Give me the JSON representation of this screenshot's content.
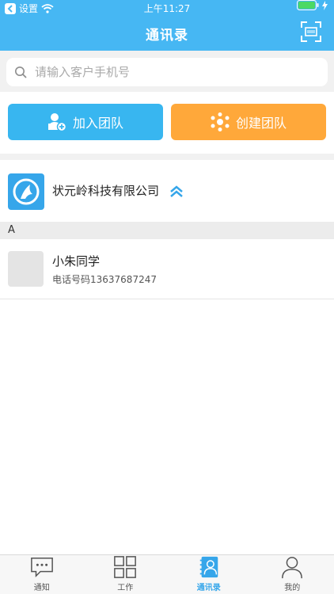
{
  "status_bar": {
    "back_app": "设置",
    "time": "上午11:27"
  },
  "header": {
    "title": "通讯录"
  },
  "search": {
    "placeholder": "请输入客户手机号",
    "value": ""
  },
  "actions": {
    "join_label": "加入团队",
    "create_label": "创建团队"
  },
  "company": {
    "name": "状元岭科技有限公司"
  },
  "contacts": {
    "section_letter": "A",
    "items": [
      {
        "name": "小朱同学",
        "phone": "电话号码13637687247"
      }
    ]
  },
  "tabs": [
    {
      "label": "通知",
      "icon": "chat-icon",
      "active": false
    },
    {
      "label": "工作",
      "icon": "grid-icon",
      "active": false
    },
    {
      "label": "通讯录",
      "icon": "contacts-book-icon",
      "active": true
    },
    {
      "label": "我的",
      "icon": "person-icon",
      "active": false
    }
  ],
  "colors": {
    "header": "#46b7f3",
    "join_button": "#38b6f0",
    "create_button": "#ffa83a",
    "active_tab": "#36a6ea"
  }
}
